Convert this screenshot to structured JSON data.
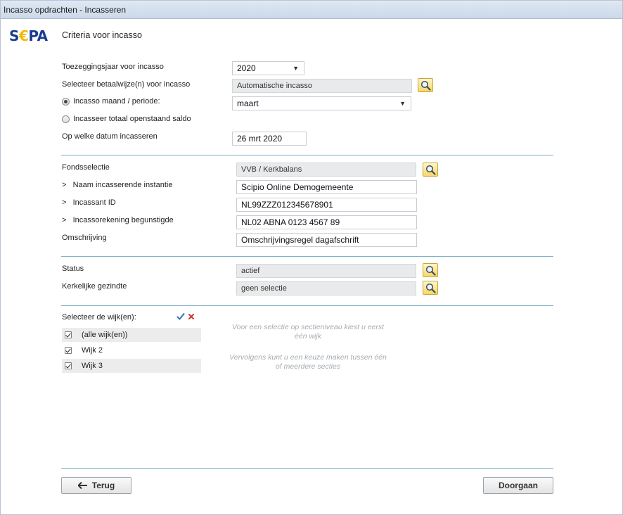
{
  "window": {
    "title": "Incasso opdrachten - Incasseren"
  },
  "header": {
    "logo_text_left": "S",
    "logo_text_euro": "€",
    "logo_text_right": "PA",
    "title": "Criteria voor incasso"
  },
  "form": {
    "year_label": "Toezeggingsjaar voor incasso",
    "year_value": "2020",
    "paymethod_label": "Selecteer betaalwijze(n) voor incasso",
    "paymethod_value": "Automatische incasso",
    "radio_month_label": "Incasso maand / periode:",
    "radio_month_selected": true,
    "month_value": "maart",
    "radio_total_label": "Incasseer totaal openstaand saldo",
    "date_label": "Op welke datum incasseren",
    "date_value": "26 mrt 2020"
  },
  "fund": {
    "fund_label": "Fondsselectie",
    "fund_value": "VVB / Kerkbalans",
    "name_label": "Naam incasserende instantie",
    "name_value": "Scipio Online Demogemeente",
    "id_label": "Incassant ID",
    "id_value": "NL99ZZZ012345678901",
    "account_label": "Incassorekening begunstigde",
    "account_value": "NL02 ABNA 0123 4567 89",
    "desc_label": "Omschrijving",
    "desc_value": "Omschrijvingsregel dagafschrift",
    "prefix": ">"
  },
  "status": {
    "status_label": "Status",
    "status_value": "actief",
    "church_label": "Kerkelijke gezindte",
    "church_value": "geen selectie"
  },
  "wijk": {
    "label": "Selecteer de wijk(en):",
    "items": [
      {
        "label": "(alle wijk(en))",
        "checked": true
      },
      {
        "label": "Wijk 2",
        "checked": true
      },
      {
        "label": "Wijk 3",
        "checked": true
      }
    ],
    "hint1": "Voor een selectie op sectieniveau kiest u eerst één wijk",
    "hint2": "Vervolgens kunt u een keuze maken tussen één of meerdere secties"
  },
  "footer": {
    "back_label": "Terug",
    "next_label": "Doorgaan"
  },
  "colors": {
    "divider": "#7fb2c9",
    "logo_blue": "#1b3b8f",
    "logo_yellow": "#f5b800",
    "check_blue": "#2f6fc5",
    "cross_red": "#d6362b"
  }
}
